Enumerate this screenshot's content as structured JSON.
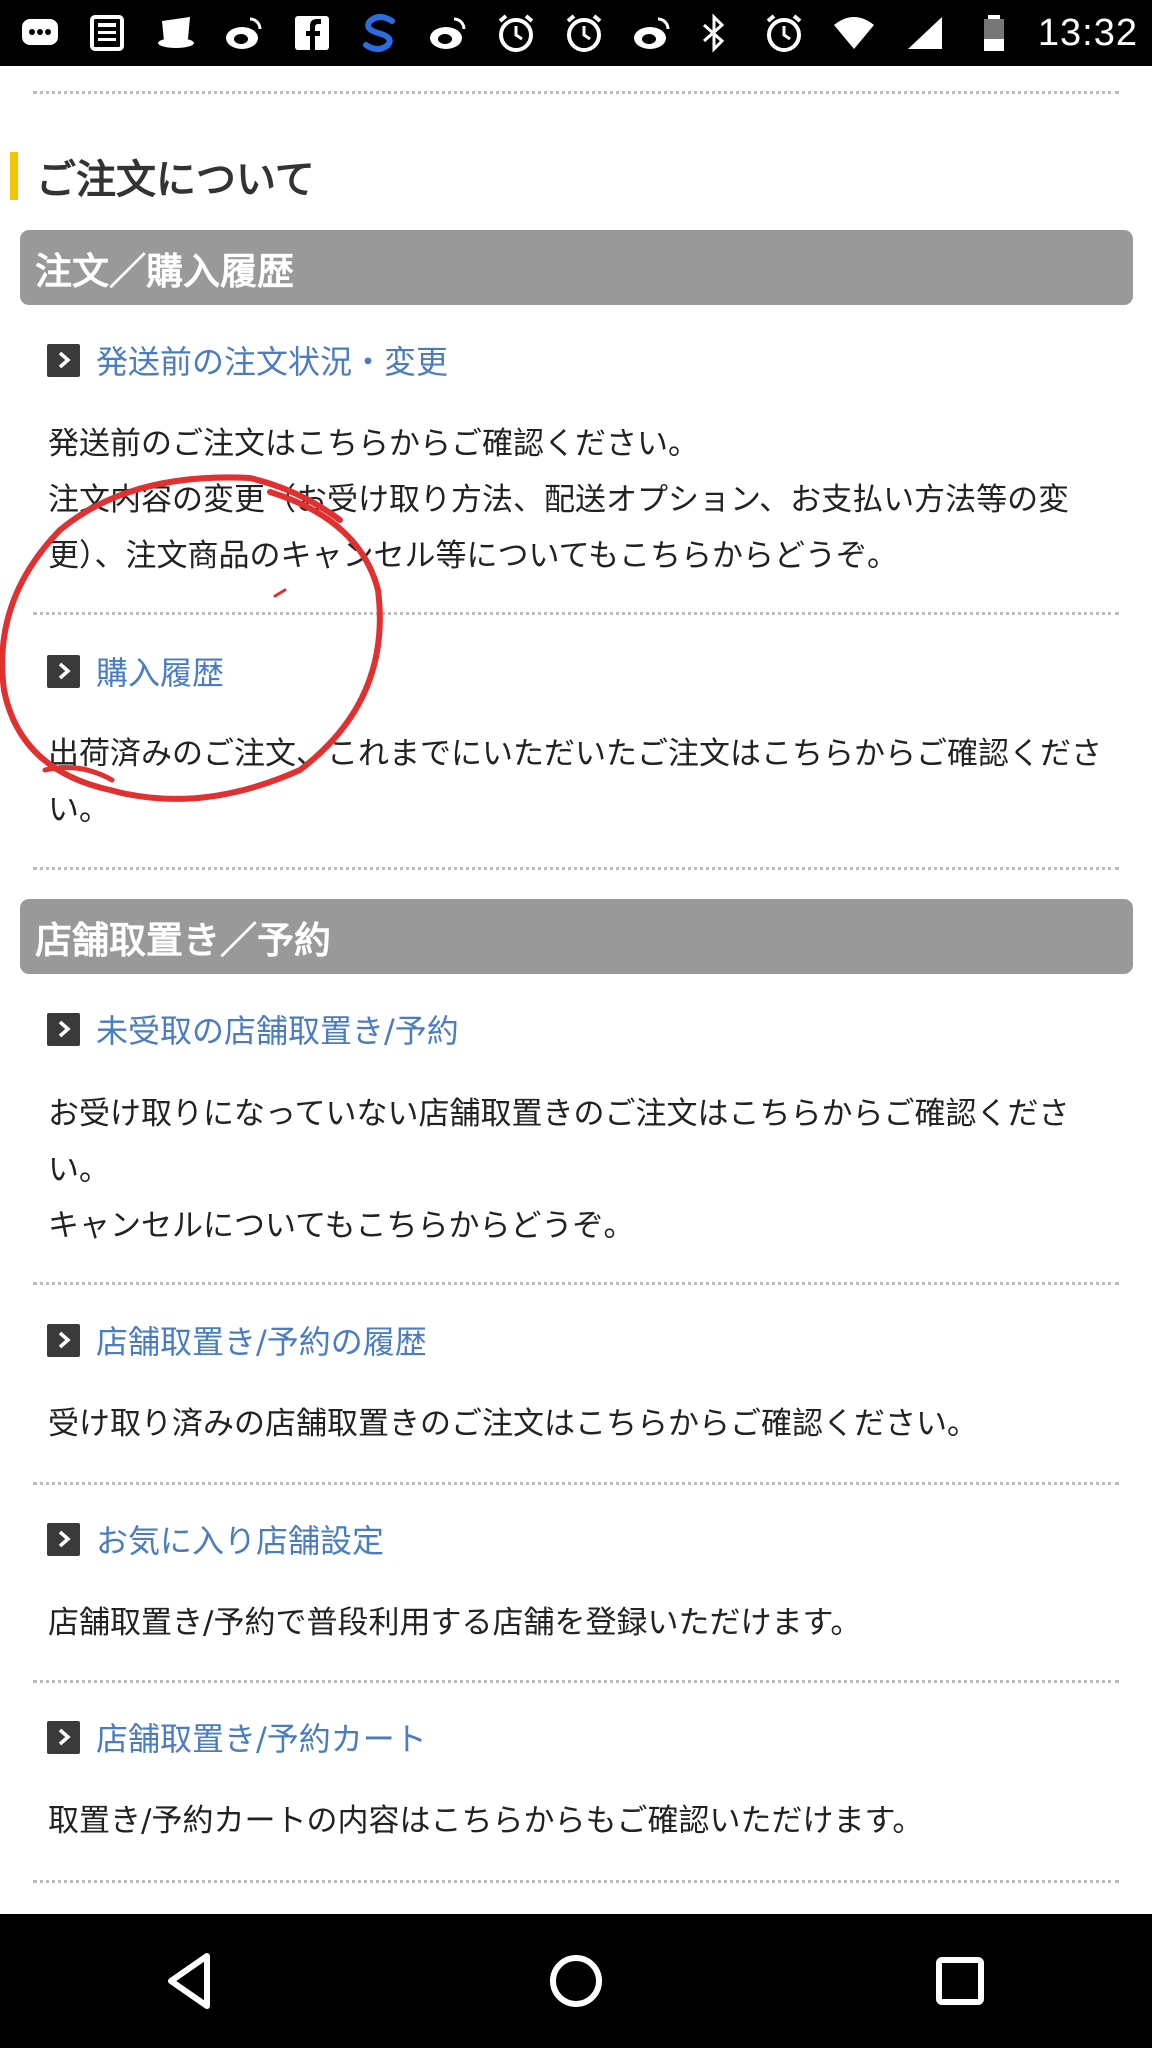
{
  "status_bar": {
    "time": "13:32",
    "left_icons": [
      "chat-icon",
      "news-icon",
      "hat-icon",
      "weibo-icon",
      "facebook-icon",
      "s-app-icon",
      "weibo-icon",
      "alarm-icon",
      "alarm-icon",
      "weibo-icon"
    ],
    "right_icons": [
      "bluetooth-icon",
      "alarm-icon",
      "wifi-icon",
      "signal-icon",
      "battery-icon"
    ]
  },
  "page": {
    "title": "ご注文について"
  },
  "sections": [
    {
      "header": "注文／購入履歴",
      "items": [
        {
          "link": "発送前の注文状況・変更",
          "desc": [
            "発送前のご注文はこちらからご確認ください。",
            "注文内容の変更（お受け取り方法、配送オプション、お支払い方法等の変更）、注文商品のキャンセル等についてもこちらからどうぞ。"
          ]
        },
        {
          "link": "購入履歴",
          "desc": [
            "出荷済みのご注文、これまでにいただいたご注文はこちらからご確認ください。"
          ]
        }
      ]
    },
    {
      "header": "店舗取置き／予約",
      "items": [
        {
          "link": "未受取の店舗取置き/予約",
          "desc": [
            "お受け取りになっていない店舗取置きのご注文はこちらからご確認ください。",
            "キャンセルについてもこちらからどうぞ。"
          ]
        },
        {
          "link": "店舗取置き/予約の履歴",
          "desc": [
            "受け取り済みの店舗取置きのご注文はこちらからご確認ください。"
          ]
        },
        {
          "link": "お気に入り店舗設定",
          "desc": [
            "店舗取置き/予約で普段利用する店舗を登録いただけます。"
          ]
        },
        {
          "link": "店舗取置き/予約カート",
          "desc": [
            "取置き/予約カートの内容はこちらからもご確認いただけます。"
          ]
        }
      ]
    }
  ],
  "nav_bar": {
    "buttons": [
      "back-icon",
      "home-icon",
      "recents-icon"
    ]
  },
  "colors": {
    "link": "#4a7cc2",
    "section_header_bg": "#999999",
    "title_accent": "#f5c400",
    "annotation": "#e03030"
  }
}
